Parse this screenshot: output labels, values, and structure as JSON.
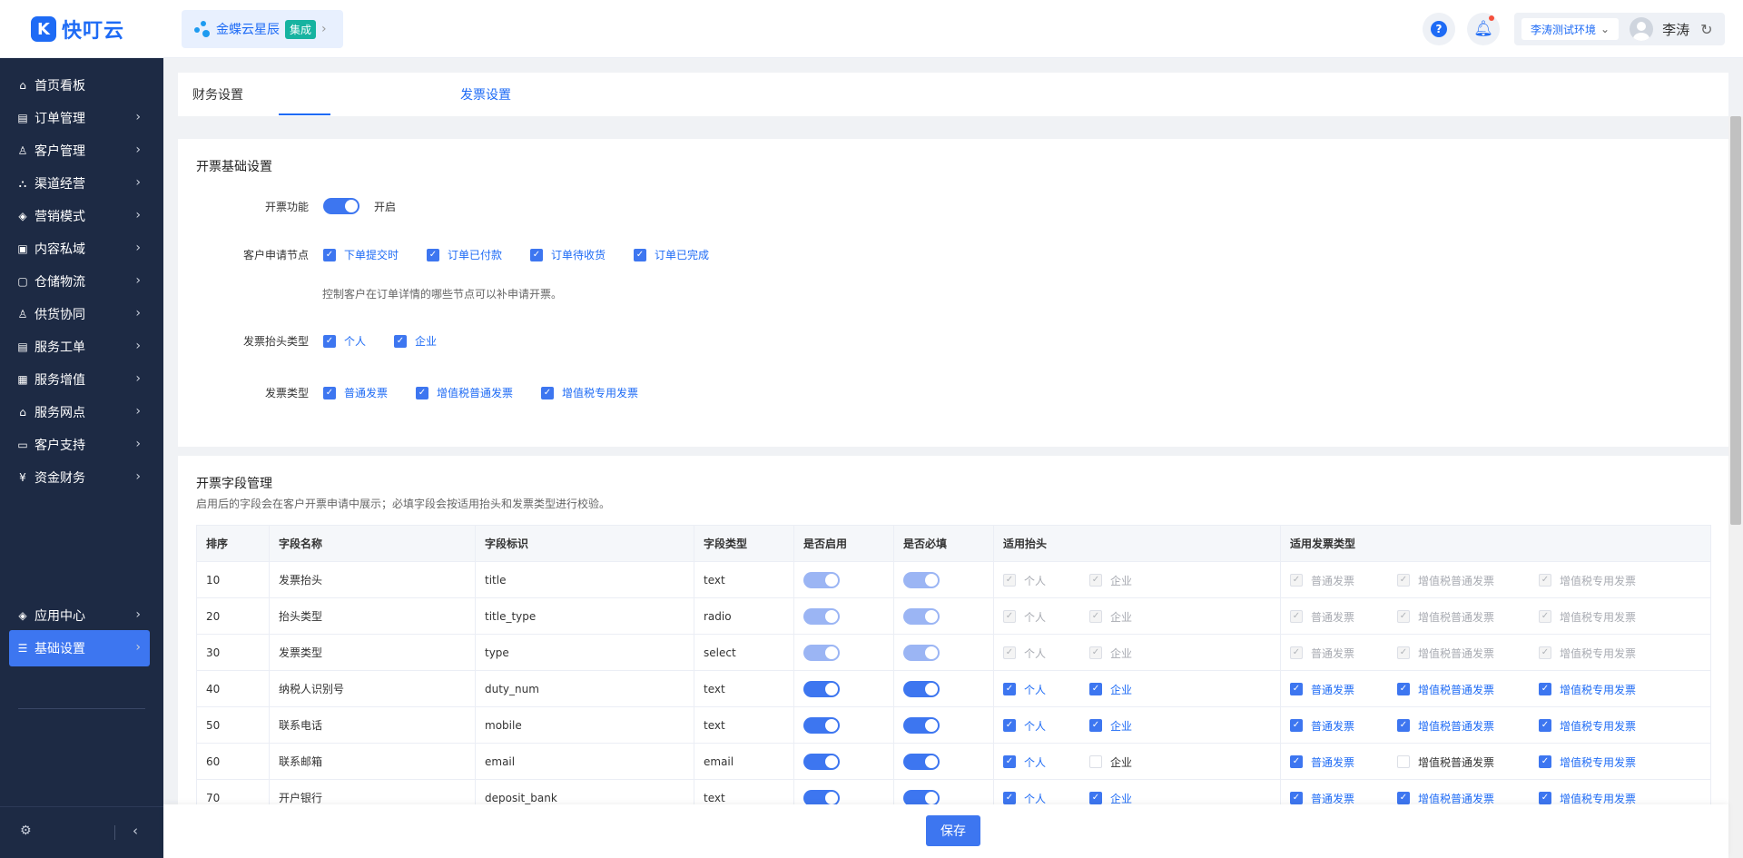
{
  "brand": {
    "logo_letter": "K",
    "name": "快叮云"
  },
  "app_switch": {
    "name": "金蝶云星辰",
    "tag": "集成"
  },
  "header": {
    "help_icon": "?",
    "env": "李涛测试环境",
    "user": "李涛"
  },
  "sidebar": {
    "items": [
      {
        "label": "首页看板",
        "icon": "home-icon",
        "glyph": "⌂"
      },
      {
        "label": "订单管理",
        "icon": "order-icon",
        "glyph": "▤"
      },
      {
        "label": "客户管理",
        "icon": "user-icon",
        "glyph": "♙"
      },
      {
        "label": "渠道经营",
        "icon": "channel-icon",
        "glyph": "⛬"
      },
      {
        "label": "营销模式",
        "icon": "tag-icon",
        "glyph": "◈"
      },
      {
        "label": "内容私域",
        "icon": "image-icon",
        "glyph": "▣"
      },
      {
        "label": "仓储物流",
        "icon": "box-icon",
        "glyph": "▢"
      },
      {
        "label": "供货协同",
        "icon": "supply-icon",
        "glyph": "♙"
      },
      {
        "label": "服务工单",
        "icon": "ticket-icon",
        "glyph": "▤"
      },
      {
        "label": "服务增值",
        "icon": "bag-icon",
        "glyph": "▦"
      },
      {
        "label": "服务网点",
        "icon": "shop-icon",
        "glyph": "⌂"
      },
      {
        "label": "客户支持",
        "icon": "support-icon",
        "glyph": "▭"
      },
      {
        "label": "资金财务",
        "icon": "money-icon",
        "glyph": "¥"
      },
      {
        "label": "应用中心",
        "icon": "app-center-icon",
        "glyph": "◈"
      },
      {
        "label": "基础设置",
        "icon": "settings-icon",
        "glyph": "☰"
      }
    ]
  },
  "tabs": [
    "财务设置",
    "发票设置"
  ],
  "basic": {
    "title": "开票基础设置",
    "invoice_func_label": "开票功能",
    "invoice_func_state": "开启",
    "apply_node_label": "客户申请节点",
    "apply_nodes": [
      "下单提交时",
      "订单已付款",
      "订单待收货",
      "订单已完成"
    ],
    "apply_hint": "控制客户在订单详情的哪些节点可以补申请开票。",
    "header_type_label": "发票抬头类型",
    "header_types": [
      "个人",
      "企业"
    ],
    "invoice_type_label": "发票类型",
    "invoice_types": [
      "普通发票",
      "增值税普通发票",
      "增值税专用发票"
    ]
  },
  "fields": {
    "title": "开票字段管理",
    "desc": "启用后的字段会在客户开票申请中展示；必填字段会按适用抬头和发票类型进行校验。",
    "columns": [
      "排序",
      "字段名称",
      "字段标识",
      "字段类型",
      "是否启用",
      "是否必填",
      "适用抬头",
      "适用发票类型"
    ],
    "header_opts": [
      "个人",
      "企业"
    ],
    "type_opts": [
      "普通发票",
      "增值税普通发票",
      "增值税专用发票"
    ],
    "rows": [
      {
        "order": "10",
        "name": "发票抬头",
        "key": "title",
        "type": "text",
        "disabled": true,
        "hdr": [
          true,
          true
        ],
        "inv": [
          true,
          true,
          true
        ]
      },
      {
        "order": "20",
        "name": "抬头类型",
        "key": "title_type",
        "type": "radio",
        "disabled": true,
        "hdr": [
          true,
          true
        ],
        "inv": [
          true,
          true,
          true
        ]
      },
      {
        "order": "30",
        "name": "发票类型",
        "key": "type",
        "type": "select",
        "disabled": true,
        "hdr": [
          true,
          true
        ],
        "inv": [
          true,
          true,
          true
        ]
      },
      {
        "order": "40",
        "name": "纳税人识别号",
        "key": "duty_num",
        "type": "text",
        "disabled": false,
        "hdr": [
          true,
          true
        ],
        "inv": [
          true,
          true,
          true
        ]
      },
      {
        "order": "50",
        "name": "联系电话",
        "key": "mobile",
        "type": "text",
        "disabled": false,
        "hdr": [
          true,
          true
        ],
        "inv": [
          true,
          true,
          true
        ]
      },
      {
        "order": "60",
        "name": "联系邮箱",
        "key": "email",
        "type": "email",
        "disabled": false,
        "hdr": [
          true,
          false
        ],
        "inv": [
          true,
          false,
          true
        ]
      },
      {
        "order": "70",
        "name": "开户银行",
        "key": "deposit_bank",
        "type": "text",
        "disabled": false,
        "hdr": [
          true,
          true
        ],
        "inv": [
          true,
          true,
          true
        ]
      }
    ]
  },
  "save_label": "保存",
  "colors": {
    "accent": "#3d76f0",
    "sidebar": "#1d2a44",
    "brand": "#1e6bf5"
  }
}
